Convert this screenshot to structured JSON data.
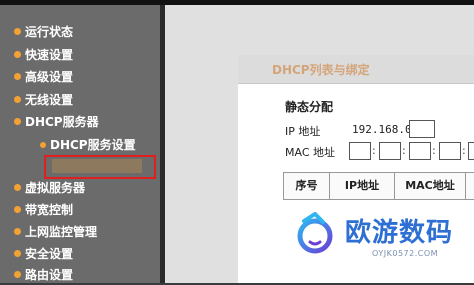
{
  "sidebar": {
    "items": [
      {
        "label": "运行状态"
      },
      {
        "label": "快速设置"
      },
      {
        "label": "高级设置"
      },
      {
        "label": "无线设置"
      },
      {
        "label": "DHCP服务器"
      },
      {
        "label": "DHCP服务设置"
      },
      {
        "label": "虚拟服务器"
      },
      {
        "label": "带宽控制"
      },
      {
        "label": "上网监控管理"
      },
      {
        "label": "安全设置"
      },
      {
        "label": "路由设置"
      }
    ]
  },
  "panel": {
    "title": "DHCP列表与绑定",
    "section_title": "静态分配",
    "ip_label": "IP 地址",
    "ip_prefix": "192.168.0.",
    "mac_label": "MAC 地址",
    "mac_separator": ":",
    "table_headers": [
      "序号",
      "IP地址",
      "MAC地址"
    ]
  },
  "watermark": {
    "brand": "欧游数码",
    "url": "OYJK0572.COM"
  },
  "colors": {
    "sidebar_bg": "#6b6b6b",
    "bullet": "#f2a233",
    "highlight_border": "#e02020",
    "brand_blue": "#2d6fd3"
  }
}
